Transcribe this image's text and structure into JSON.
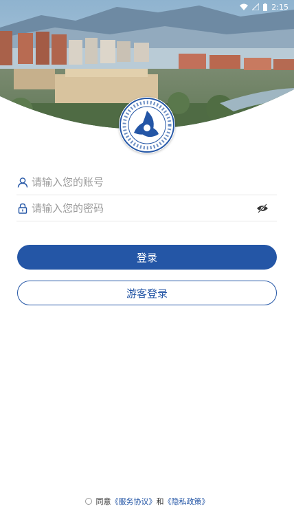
{
  "status_bar": {
    "time": "2:15",
    "wifi_icon": "wifi-icon",
    "signal_icon": "signal-icon",
    "battery_icon": "battery-icon"
  },
  "login_form": {
    "account_placeholder": "请输入您的账号",
    "password_placeholder": "请输入您的密码",
    "account_icon": "user-icon",
    "password_icon": "lock-icon",
    "visibility_icon": "eye-off-icon"
  },
  "buttons": {
    "login_label": "登录",
    "guest_label": "游客登录"
  },
  "agreement": {
    "prefix": "同意",
    "service_link": "《服务协议》",
    "connector": "和",
    "privacy_link": "《隐私政策》"
  },
  "colors": {
    "primary": "#2456a6",
    "placeholder": "#9a9a9a",
    "divider": "#e6e6e6"
  }
}
